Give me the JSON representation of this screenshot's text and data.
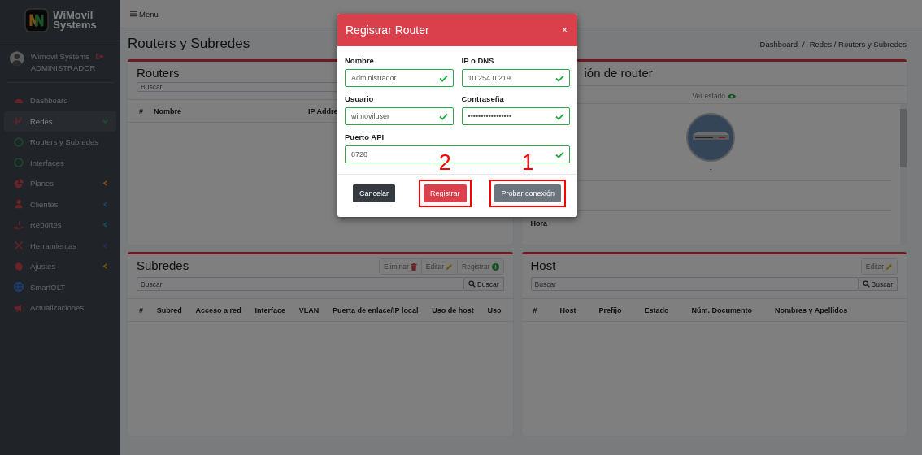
{
  "sidebar": {
    "logo": {
      "lines": [
        "WiMovil",
        "Systems"
      ]
    },
    "user": {
      "name": "Wimovil Systems",
      "role": "ADMINISTRADOR"
    },
    "items": [
      {
        "label": "Dashboard",
        "selected": false
      },
      {
        "label": "Redes",
        "selected": true,
        "expanded": true,
        "color": "#145322",
        "children": [
          {
            "label": "Routers y Subredes",
            "selected": false
          },
          {
            "label": "Interfaces",
            "selected": false
          }
        ]
      },
      {
        "label": "Planes",
        "selected": false,
        "expanded": false,
        "color": "#8a4a14"
      },
      {
        "label": "Clientes",
        "selected": false,
        "expanded": false,
        "color": "#1d3e6e"
      },
      {
        "label": "Reportes",
        "selected": false,
        "expanded": false,
        "color": "#0b515c"
      },
      {
        "label": "Herramientas",
        "selected": false,
        "expanded": false,
        "color": "#372160"
      },
      {
        "label": "Ajustes",
        "selected": false,
        "expanded": false,
        "color": "#705400"
      },
      {
        "label": "SmartOLT",
        "selected": false
      },
      {
        "label": "Actualizaciones",
        "selected": false
      }
    ]
  },
  "topbar": {
    "menu_label": "Menu"
  },
  "page": {
    "title": "Routers y Subredes",
    "breadcrumb": [
      "Dashboard",
      "Redes / Routers y Subredes"
    ],
    "breadcrumb_separator": "/"
  },
  "routers_card": {
    "title": "Routers",
    "search_placeholder": "Buscar",
    "columns": [
      "#",
      "Nombre",
      "IP Addre"
    ]
  },
  "router_info_card": {
    "title": "ión de router",
    "status_link": "Ver estado",
    "caption": "-",
    "rows": [
      {
        "label": "Hora"
      }
    ]
  },
  "subnets_card": {
    "title": "Subredes",
    "actions": [
      {
        "label": "Eliminar",
        "kind": "delete"
      },
      {
        "label": "Editar",
        "kind": "edit"
      },
      {
        "label": "Registrar",
        "kind": "add"
      }
    ],
    "search_placeholder": "Buscar",
    "search_button": "Buscar",
    "columns": [
      "#",
      "Subred",
      "Acceso a red",
      "Interface",
      "VLAN",
      "Puerta de enlace/IP local",
      "Uso de host",
      "Uso"
    ]
  },
  "hosts_card": {
    "title": "Host",
    "actions": [
      {
        "label": "Editar",
        "kind": "edit"
      }
    ],
    "search_placeholder": "Buscar",
    "search_button": "Buscar",
    "columns": [
      "#",
      "Host",
      "Prefijo",
      "Estado",
      "Núm. Documento",
      "Nombres y Apellidos"
    ]
  },
  "modal": {
    "title": "Registrar Router",
    "close": "×",
    "fields": [
      {
        "label": "Nombre",
        "value": "Administrador",
        "valid": true
      },
      {
        "label": "IP o DNS",
        "value": "10.254.0.219",
        "valid": true
      },
      {
        "label": "Usuario",
        "value": "wimoviluser",
        "valid": true
      },
      {
        "label": "Contraseña",
        "value": "•••••••••••••••••",
        "valid": true
      },
      {
        "label": "Puerto API",
        "value": "8728",
        "valid": true
      }
    ],
    "buttons": [
      {
        "label": "Cancelar",
        "kind": "cancel"
      },
      {
        "label": "Registrar",
        "kind": "primary",
        "annotation": "2"
      },
      {
        "label": "Probar conexión",
        "kind": "test",
        "annotation": "1"
      }
    ]
  }
}
